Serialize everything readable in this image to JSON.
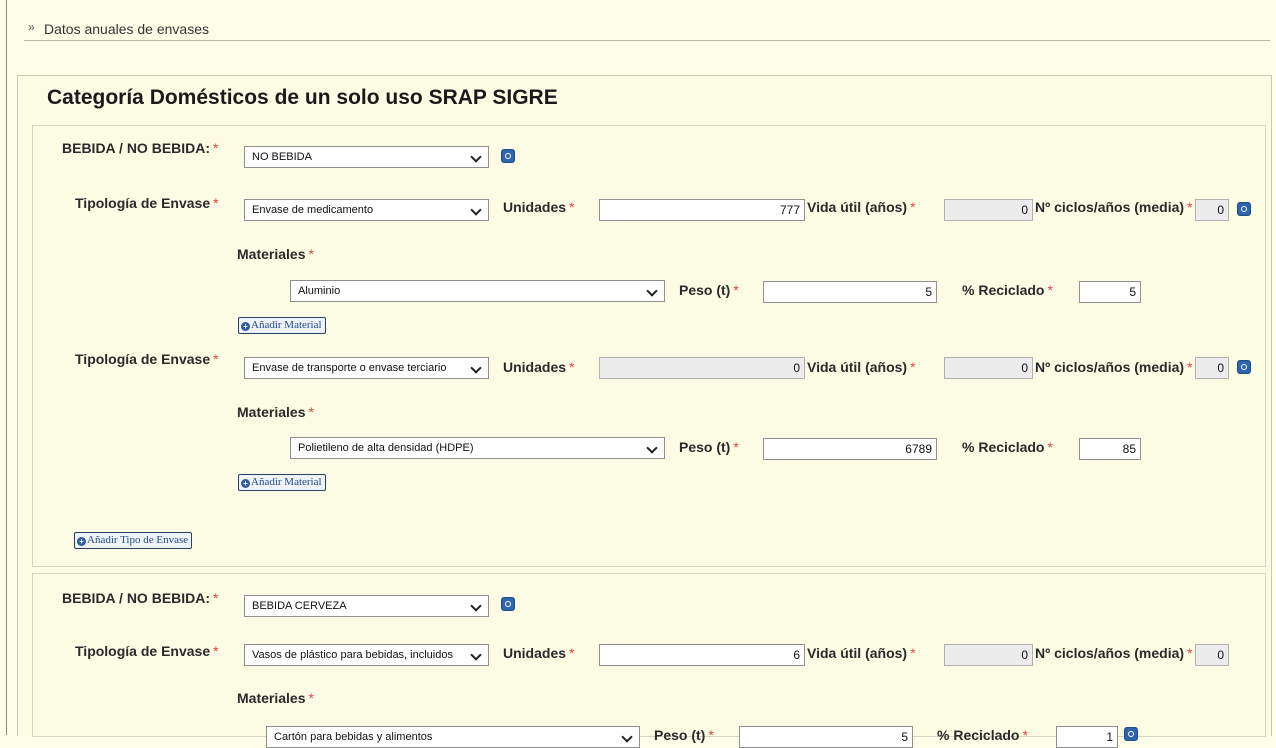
{
  "section": {
    "arrow": "»",
    "title": "Datos anuales de envases"
  },
  "category_title": "Categoría Domésticos de un solo uso SRAP  SIGRE",
  "labels": {
    "bebida": "BEBIDA / NO BEBIDA:",
    "tipologia": "Tipología de Envase",
    "unidades": "Unidades",
    "vida_util": "Vida útil (años)",
    "ciclos": "Nº ciclos/años (media)",
    "materiales": "Materiales",
    "peso": "Peso (t)",
    "reciclado": "% Reciclado",
    "required_mark": "*"
  },
  "buttons": {
    "add_material": "Añadir Material",
    "add_tipo": "Añadir Tipo de Envase"
  },
  "groups": [
    {
      "bebida": "NO BEBIDA",
      "tipos": [
        {
          "tipologia": "Envase de medicamento",
          "unidades": "777",
          "vida_util": "0",
          "ciclos": "0",
          "materiales": [
            {
              "material": "Aluminio",
              "peso": "5",
              "reciclado": "5"
            }
          ]
        },
        {
          "tipologia": "Envase de transporte o envase terciario",
          "unidades": "0",
          "vida_util": "0",
          "ciclos": "0",
          "materiales": [
            {
              "material": "Polietileno de alta densidad (HDPE)",
              "peso": "6789",
              "reciclado": "85"
            }
          ]
        }
      ]
    },
    {
      "bebida": "BEBIDA CERVEZA",
      "tipos": [
        {
          "tipologia": "Vasos de plástico para bebidas, incluidos",
          "unidades": "6",
          "vida_util": "0",
          "ciclos": "0",
          "materiales": [
            {
              "material": "Cartón para bebidas y alimentos",
              "peso": "5",
              "reciclado": "1"
            }
          ]
        }
      ]
    }
  ]
}
